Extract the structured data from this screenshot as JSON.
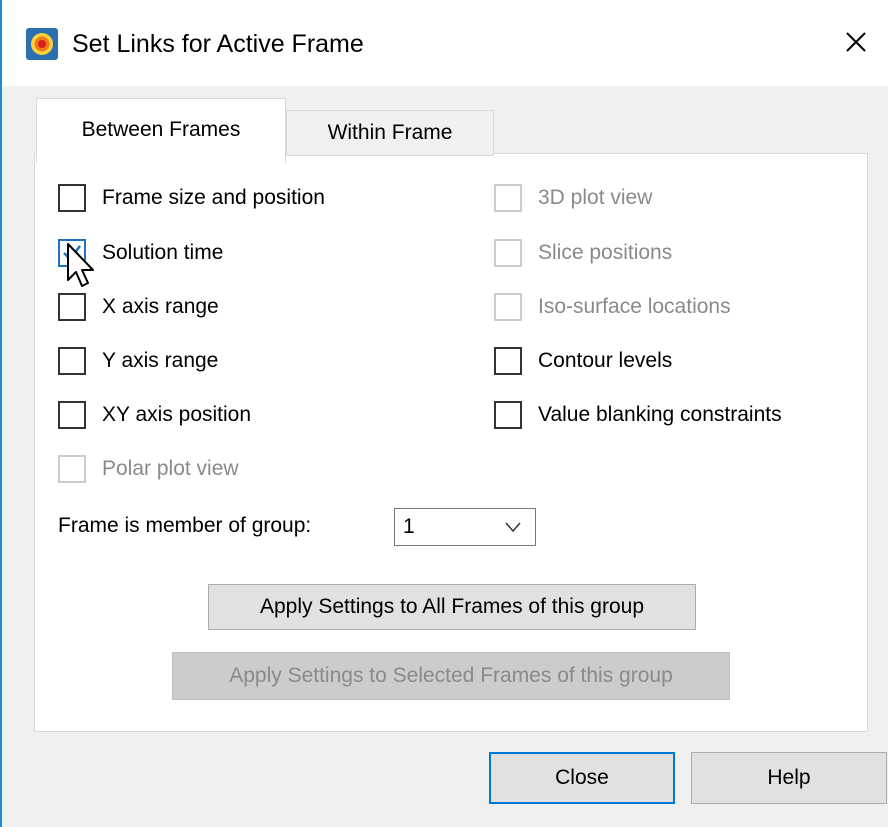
{
  "window": {
    "title": "Set Links for Active Frame"
  },
  "tabs": [
    {
      "label": "Between Frames",
      "active": true
    },
    {
      "label": "Within Frame",
      "active": false
    }
  ],
  "left_options": [
    {
      "label": "Frame size and position",
      "checked": false,
      "enabled": true
    },
    {
      "label": "Solution time",
      "checked": true,
      "enabled": true
    },
    {
      "label": "X axis range",
      "checked": false,
      "enabled": true
    },
    {
      "label": "Y axis range",
      "checked": false,
      "enabled": true
    },
    {
      "label": "XY axis position",
      "checked": false,
      "enabled": true
    },
    {
      "label": "Polar plot view",
      "checked": false,
      "enabled": false
    }
  ],
  "right_options": [
    {
      "label": "3D plot view",
      "checked": false,
      "enabled": false
    },
    {
      "label": "Slice positions",
      "checked": false,
      "enabled": false
    },
    {
      "label": "Iso-surface locations",
      "checked": false,
      "enabled": false
    },
    {
      "label": "Contour levels",
      "checked": false,
      "enabled": true
    },
    {
      "label": "Value blanking constraints",
      "checked": false,
      "enabled": true
    }
  ],
  "group": {
    "label": "Frame is member of group:",
    "value": "1"
  },
  "buttons": {
    "apply_all": "Apply Settings to All Frames of this group",
    "apply_selected": "Apply Settings to Selected Frames of this group",
    "close": "Close",
    "help": "Help"
  },
  "icons": {
    "app": "tecplot-app-icon",
    "close": "close-icon",
    "dropdown": "chevron-down-icon",
    "cursor": "mouse-pointer-icon"
  },
  "colors": {
    "accent": "#0078d7",
    "window_border": "#1f8ad6",
    "disabled_text": "#8a8a8a"
  }
}
